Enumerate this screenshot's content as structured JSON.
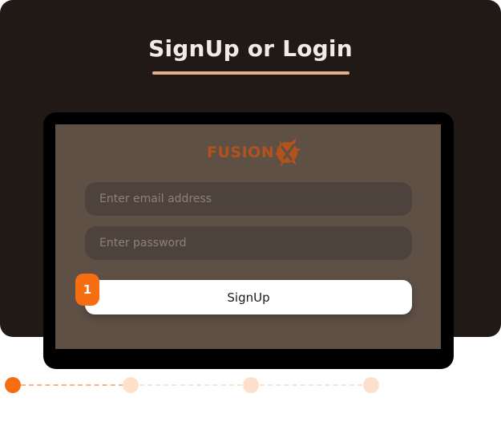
{
  "heading": {
    "title": "SignUp or Login"
  },
  "logo": {
    "text": "FUSION",
    "mark": "X"
  },
  "form": {
    "email_placeholder": "Enter email address",
    "password_placeholder": "Enter password",
    "signup_label": "SignUp",
    "step_badge": "1"
  },
  "stepper": {
    "steps": [
      {
        "state": "active"
      },
      {
        "state": "inactive"
      },
      {
        "state": "inactive"
      },
      {
        "state": "inactive"
      }
    ]
  },
  "colors": {
    "accent": "#f76e12",
    "card_background": "#201916",
    "screen_background": "#5f5045",
    "underline": "#e7b08b",
    "logo": "#b4521d"
  }
}
